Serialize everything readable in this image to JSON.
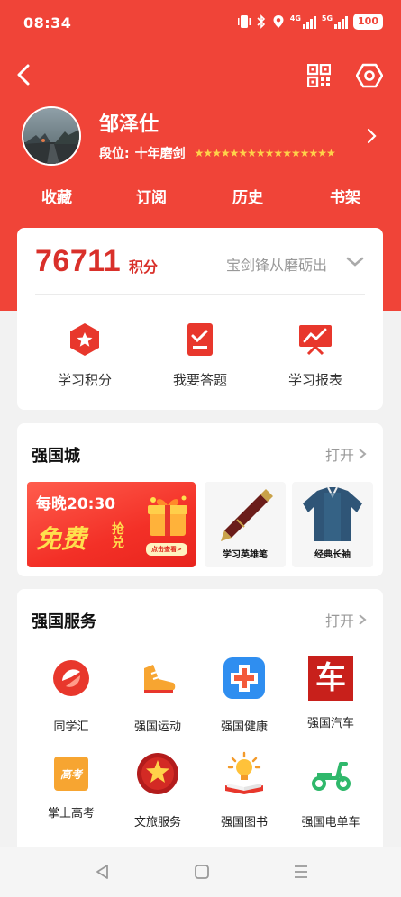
{
  "status_bar": {
    "time": "08:34",
    "battery": "100",
    "network_1": "4G",
    "network_2": "5G"
  },
  "profile": {
    "username": "邹泽仕",
    "rank_label": "段位:",
    "rank_value": "十年磨剑",
    "stars": "★★★★★★★★★★★★★★★★",
    "star_count": 16
  },
  "nav_tabs": [
    "收藏",
    "订阅",
    "历史",
    "书架"
  ],
  "points": {
    "value": "76711",
    "unit": "积分",
    "motto": "宝剑锋从磨砺出",
    "actions": [
      {
        "label": "学习积分",
        "icon": "points-hexagon-icon"
      },
      {
        "label": "我要答题",
        "icon": "quiz-checklist-icon"
      },
      {
        "label": "学习报表",
        "icon": "report-board-icon"
      }
    ]
  },
  "mall": {
    "title": "强国城",
    "open_label": "打开",
    "banner": {
      "time_text": "每晚20:30",
      "free_text": "免费",
      "claim_text": "抢兑",
      "button_text": "点击查看>"
    },
    "products": [
      {
        "label": "学习英雄笔",
        "icon": "fountain-pen-icon"
      },
      {
        "label": "经典长袖",
        "icon": "sweater-icon"
      }
    ]
  },
  "services": {
    "title": "强国服务",
    "open_label": "打开",
    "items": [
      {
        "label": "同学汇",
        "icon": "tongxuehui-icon"
      },
      {
        "label": "强国运动",
        "icon": "sports-shoe-icon"
      },
      {
        "label": "强国健康",
        "icon": "health-cross-icon"
      },
      {
        "label": "强国汽车",
        "icon": "car-char-icon",
        "glyph": "车"
      },
      {
        "label": "掌上高考",
        "icon": "gaokao-icon",
        "glyph": "高考"
      },
      {
        "label": "文旅服务",
        "icon": "culture-travel-icon"
      },
      {
        "label": "强国图书",
        "icon": "book-lightbulb-icon"
      },
      {
        "label": "强国电单车",
        "icon": "e-scooter-icon"
      }
    ]
  },
  "colors": {
    "brand_red": "#f04438",
    "points_red": "#d9302a",
    "star_yellow": "#ffd24a",
    "scooter_green": "#2fb86b"
  }
}
